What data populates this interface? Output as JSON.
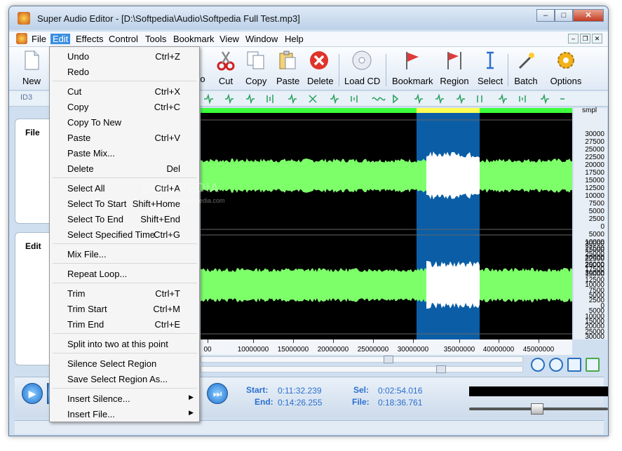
{
  "window": {
    "title": "Super Audio Editor - [D:\\Softpedia\\Audio\\Softpedia Full Test.mp3]",
    "controls": [
      "–",
      "□",
      "✕"
    ]
  },
  "menubar": [
    "File",
    "Edit",
    "Effects",
    "Control",
    "Tools",
    "Bookmark",
    "View",
    "Window",
    "Help"
  ],
  "mdi_controls": [
    "–",
    "❐",
    "✕"
  ],
  "toolbar": {
    "buttons": [
      {
        "label": "New",
        "icon": "new-file-icon"
      },
      {
        "label": "o",
        "icon": "undo-icon"
      },
      {
        "label": "Cut",
        "icon": "scissors-icon"
      },
      {
        "label": "Copy",
        "icon": "copy-icon"
      },
      {
        "label": "Paste",
        "icon": "paste-icon"
      },
      {
        "label": "Delete",
        "icon": "delete-icon"
      },
      {
        "label": "Load CD",
        "icon": "cd-icon"
      },
      {
        "label": "Bookmark",
        "icon": "bookmark-flag-icon"
      },
      {
        "label": "Region",
        "icon": "region-flag-icon"
      },
      {
        "label": "Select",
        "icon": "select-cursor-icon"
      },
      {
        "label": "Batch",
        "icon": "batch-wand-icon"
      },
      {
        "label": "Options",
        "icon": "options-gear-icon"
      }
    ],
    "effects_label": "ID3"
  },
  "left_panel": {
    "file_header": "File",
    "edit_header": "Edit"
  },
  "edit_menu": {
    "items": [
      {
        "label": "Undo",
        "shortcut": "Ctrl+Z"
      },
      {
        "label": "Redo",
        "shortcut": ""
      },
      {
        "sep": true
      },
      {
        "label": "Cut",
        "shortcut": "Ctrl+X"
      },
      {
        "label": "Copy",
        "shortcut": "Ctrl+C"
      },
      {
        "label": "Copy To New",
        "shortcut": ""
      },
      {
        "label": "Paste",
        "shortcut": "Ctrl+V"
      },
      {
        "label": "Paste Mix...",
        "shortcut": ""
      },
      {
        "label": "Delete",
        "shortcut": "Del"
      },
      {
        "sep": true
      },
      {
        "label": "Select All",
        "shortcut": "Ctrl+A"
      },
      {
        "label": "Select To Start",
        "shortcut": "Shift+Home"
      },
      {
        "label": "Select To End",
        "shortcut": "Shift+End"
      },
      {
        "label": "Select Specified Time",
        "shortcut": "Ctrl+G"
      },
      {
        "sep": true
      },
      {
        "label": "Mix File...",
        "shortcut": ""
      },
      {
        "sep": true
      },
      {
        "label": "Repeat Loop...",
        "shortcut": ""
      },
      {
        "sep": true
      },
      {
        "label": "Trim",
        "shortcut": "Ctrl+T"
      },
      {
        "label": "Trim Start",
        "shortcut": "Ctrl+M"
      },
      {
        "label": "Trim End",
        "shortcut": "Ctrl+E"
      },
      {
        "sep": true
      },
      {
        "label": "Split into two at this point",
        "shortcut": ""
      },
      {
        "sep": true
      },
      {
        "label": "Silence Select Region",
        "shortcut": ""
      },
      {
        "label": "Save Select Region As...",
        "shortcut": ""
      },
      {
        "sep": true
      },
      {
        "label": "Insert Silence...",
        "shortcut": "",
        "submenu": true
      },
      {
        "label": "Insert File...",
        "shortcut": "",
        "submenu": true
      }
    ]
  },
  "waveform": {
    "unit": "smpl",
    "scale_top": [
      "30000",
      "27500",
      "25000",
      "22500",
      "20000",
      "17500",
      "15000",
      "12500",
      "10000",
      "7500",
      "5000",
      "2500",
      "0",
      "2500",
      "5000",
      "7500",
      "10000",
      "12500",
      "15000",
      "17500",
      "20000",
      "22500",
      "25000",
      "27500",
      "30000"
    ],
    "scale_labels": [
      "30000",
      "27500",
      "25000",
      "22500",
      "20000",
      "17500",
      "15000",
      "12500",
      "10000",
      "7500",
      "5000",
      "2500",
      "0",
      "5000",
      "10000",
      "15000",
      "20000",
      "25000",
      "30000"
    ],
    "ruler": [
      "00",
      "10000000",
      "15000000",
      "20000000",
      "25000000",
      "30000000",
      "35000000",
      "40000000",
      "45000000"
    ],
    "wave_color": "#7dff6a",
    "selection_color": "#0b5ea6"
  },
  "transport": {
    "start_label": "Start:",
    "start_value": "0:11:32.239",
    "end_label": "End:",
    "end_value": "0:14:26.255",
    "sel_label": "Sel:",
    "sel_value": "0:02:54.016",
    "file_label": "File:",
    "file_value": "0:18:36.761"
  },
  "watermark": {
    "text": "SOFTPEDIA",
    "sub": "www.softpedia.com"
  }
}
